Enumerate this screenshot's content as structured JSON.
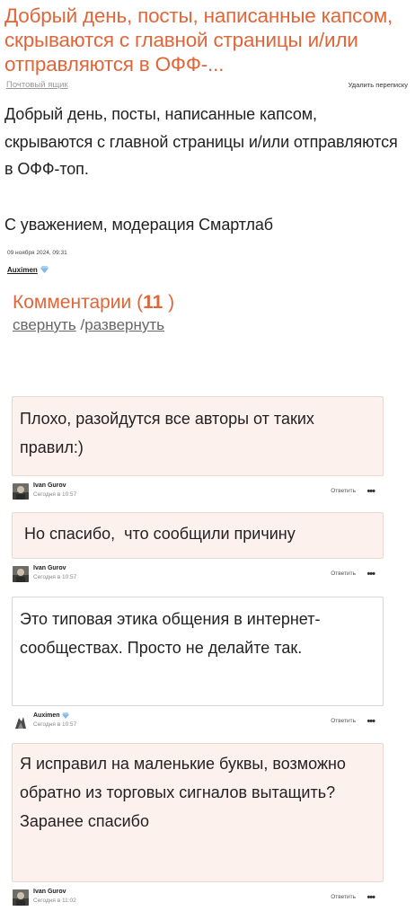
{
  "topic": {
    "title": "Добрый день, посты, написанные капсом, скрываются с главной страницы и/или отправляются в ОФФ-...",
    "mailbox_link": "Почтовый ящик",
    "delete_link": "Удалить переписку",
    "body_paragraph": "Добрый день, посты, написанные капсом, скрываются с главной страницы и/или отправляются в ОФФ-топ.",
    "body_regards": "С уважением, модерация Смартлаб",
    "date": "09 ноября 2024, 09:31",
    "author": "Auximen"
  },
  "comments_section": {
    "label": "Комментарии (",
    "count": "11",
    "close_paren": " )",
    "collapse": "свернуть",
    "separator": " /",
    "expand": "развернуть"
  },
  "comments": [
    {
      "text": "Плохо, разойдутся все авторы от таких правил:)",
      "author": "Ivan Gurov",
      "time": "Сегодня в 10:57",
      "reply": "Ответить",
      "more": "•••"
    },
    {
      "text": " Но спасибо,  что сообщили причину",
      "author": "Ivan Gurov",
      "time": "Сегодня в 10:57",
      "reply": "Ответить",
      "more": "•••"
    },
    {
      "text": "Это типовая этика общения в интернет-сообществах. Просто не делайте так.",
      "author": "Auximen",
      "time": "Сегодня в 10:57",
      "reply": "Ответить",
      "more": "•••"
    },
    {
      "text": "Я исправил на маленькие буквы, возможно обратно из торговых сигналов вытащить? Заранее спасибо",
      "author": "Ivan Gurov",
      "time": "Сегодня в 11:02",
      "reply": "Ответить",
      "more": "•••"
    }
  ],
  "colors": {
    "accent": "#e0663a",
    "bubble_bg": "#fdf1ee",
    "moderator_bubble_bg": "#ffffff"
  }
}
